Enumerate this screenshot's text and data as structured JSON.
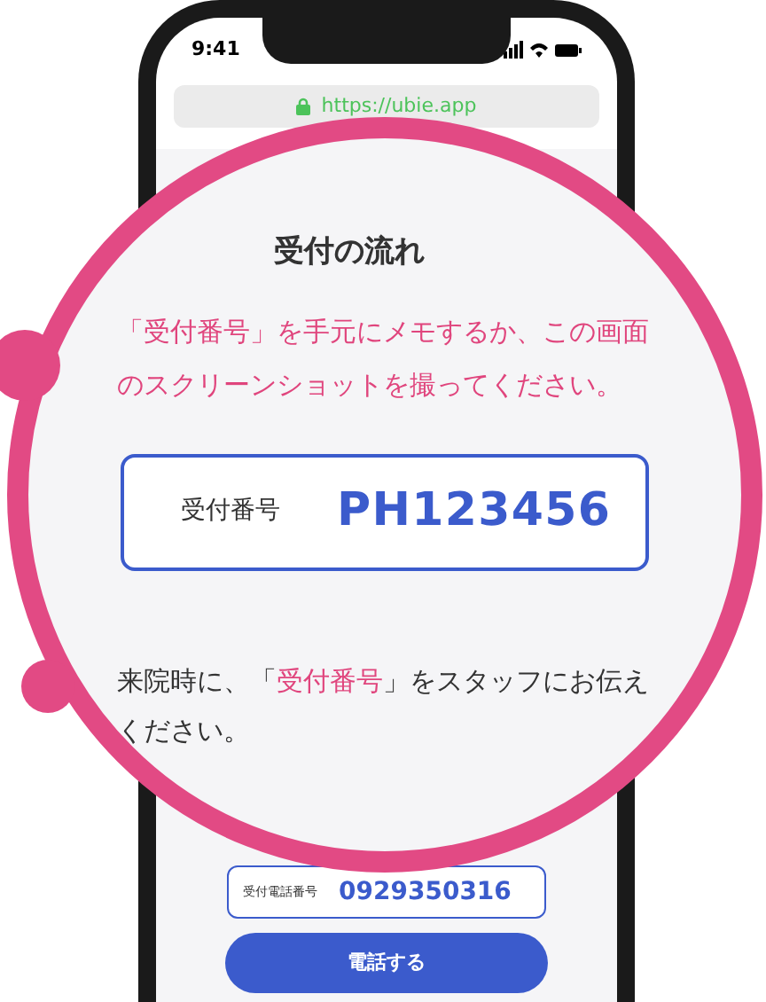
{
  "status_bar": {
    "time": "9:41"
  },
  "address_bar": {
    "url": "https://ubie.app",
    "secure": true
  },
  "magnifier": {
    "title": "受付の流れ",
    "steps": [
      {
        "kind": "note",
        "text": "「受付番号」を手元にメモするか、この画面のスクリーンショットを撮ってください。"
      },
      {
        "kind": "number",
        "label": "受付番号",
        "value": "PH123456"
      },
      {
        "kind": "text",
        "text": "来院時に、「**受付番号**」をスタッフにお伝えください。"
      }
    ]
  },
  "phone_number": {
    "label": "受付電話番号",
    "value": "0929350316"
  },
  "call_button": {
    "label": "電話する"
  }
}
